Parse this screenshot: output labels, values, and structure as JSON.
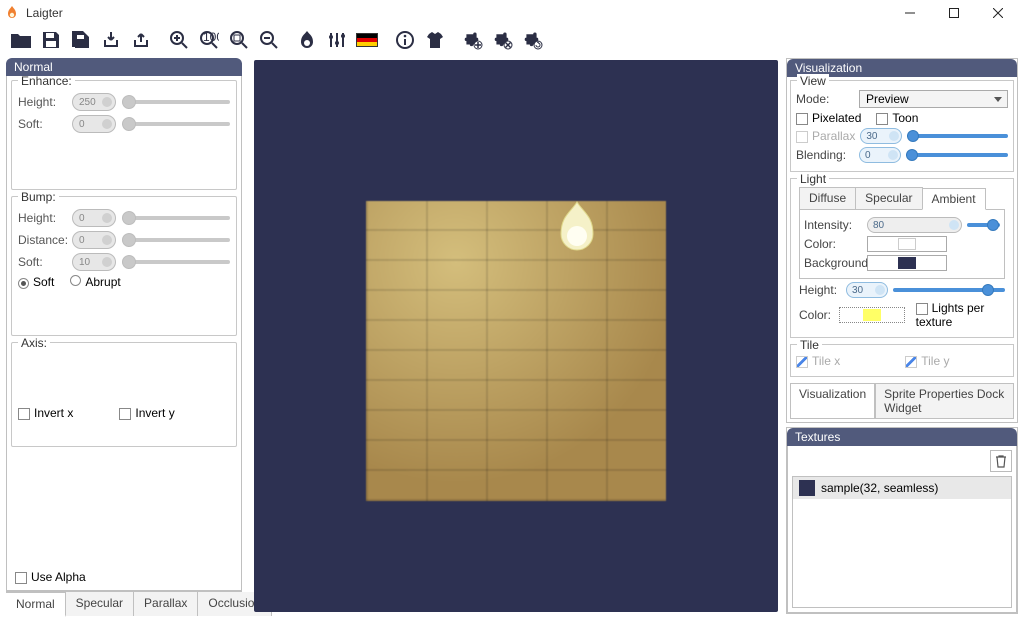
{
  "app": {
    "title": "Laigter"
  },
  "left": {
    "panel_title": "Normal",
    "enhance": {
      "legend": "Enhance:",
      "height_label": "Height:",
      "height_value": "250",
      "soft_label": "Soft:",
      "soft_value": "0"
    },
    "bump": {
      "legend": "Bump:",
      "height_label": "Height:",
      "height_value": "0",
      "distance_label": "Distance:",
      "distance_value": "0",
      "soft_label": "Soft:",
      "soft_value": "10",
      "radio_soft": "Soft",
      "radio_abrupt": "Abrupt"
    },
    "axis": {
      "legend": "Axis:",
      "invert_x": "Invert x",
      "invert_y": "Invert y"
    },
    "use_alpha": "Use Alpha",
    "tabs": {
      "normal": "Normal",
      "specular": "Specular",
      "parallax": "Parallax",
      "occlusion": "Occlusion"
    }
  },
  "right": {
    "viz_title": "Visualization",
    "view": {
      "legend": "View",
      "mode_label": "Mode:",
      "mode_value": "Preview",
      "pixelated": "Pixelated",
      "toon": "Toon",
      "parallax_label": "Parallax",
      "parallax_value": "30",
      "blending_label": "Blending:",
      "blending_value": "0"
    },
    "light": {
      "legend": "Light",
      "tabs": {
        "diffuse": "Diffuse",
        "specular": "Specular",
        "ambient": "Ambient"
      },
      "intensity_label": "Intensity:",
      "intensity_value": "80",
      "color_label": "Color:",
      "ambient_color": "#ffffff",
      "background_label": "Background:",
      "background_color": "#2d3152",
      "height_label": "Height:",
      "height_value": "30",
      "color2_label": "Color:",
      "light_color": "#ffff66",
      "lights_per_texture": "Lights per texture"
    },
    "tile": {
      "legend": "Tile",
      "tile_x": "Tile x",
      "tile_y": "Tile y"
    },
    "bottom_tabs": {
      "visualization": "Visualization",
      "sprite_props": "Sprite Properties Dock Widget"
    },
    "textures_title": "Textures",
    "texture_item": "sample(32, seamless)"
  }
}
